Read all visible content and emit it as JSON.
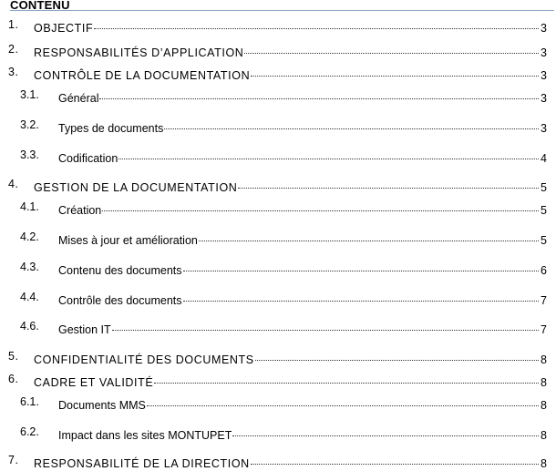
{
  "toc": {
    "heading": "CONTENU",
    "entries": [
      {
        "num": "1.",
        "label": "OBJECTIF",
        "page": "3",
        "level": 1
      },
      {
        "num": "2.",
        "label": "RESPONSABILITÉS D’APPLICATION",
        "page": "3",
        "level": 1
      },
      {
        "num": "3.",
        "label": "CONTRÔLE DE LA DOCUMENTATION",
        "page": "3",
        "level": 1
      },
      {
        "num": "3.1.",
        "label": "Général",
        "page": "3",
        "level": 2
      },
      {
        "num": "3.2.",
        "label": "Types de documents",
        "page": "3",
        "level": 2
      },
      {
        "num": "3.3.",
        "label": "Codification",
        "page": "4",
        "level": 2
      },
      {
        "num": "4.",
        "label": "GESTION DE LA DOCUMENTATION",
        "page": "5",
        "level": 1
      },
      {
        "num": "4.1.",
        "label": "Création",
        "page": "5",
        "level": 2
      },
      {
        "num": "4.2.",
        "label": "Mises à jour et amélioration",
        "page": "5",
        "level": 2
      },
      {
        "num": "4.3.",
        "label": "Contenu des documents",
        "page": "6",
        "level": 2
      },
      {
        "num": "4.4.",
        "label": "Contrôle des documents",
        "page": "7",
        "level": 2
      },
      {
        "num": "4.6.",
        "label": "Gestion IT",
        "page": "7",
        "level": 2
      },
      {
        "num": "5.",
        "label": "CONFIDENTIALITÉ DES DOCUMENTS",
        "page": "8",
        "level": 1
      },
      {
        "num": "6.",
        "label": "CADRE ET VALIDITÉ",
        "page": "8",
        "level": 1
      },
      {
        "num": "6.1.",
        "label": "Documents MMS",
        "page": "8",
        "level": 2
      },
      {
        "num": "6.2.",
        "label": "Impact dans les sites MONTUPET",
        "page": "8",
        "level": 2
      },
      {
        "num": "7.",
        "label": "RESPONSABILITÉ DE LA DIRECTION",
        "page": "8",
        "level": 1
      }
    ]
  }
}
